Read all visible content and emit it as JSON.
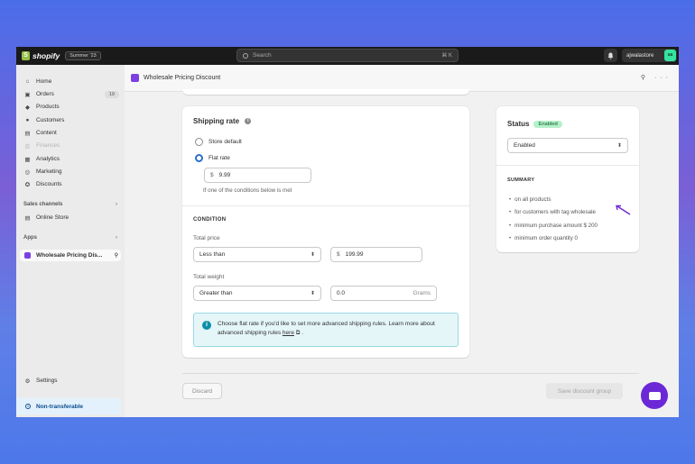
{
  "topbar": {
    "logo_letter": "S",
    "brand": "shopify",
    "edition": "Summer '23",
    "search_placeholder": "Search",
    "search_shortcut": "⌘ K",
    "store_name": "ajwalastore",
    "store_avatar": "aa"
  },
  "sidebar": {
    "items": [
      {
        "label": "Home",
        "icon": "home-icon",
        "glyph": "⌂"
      },
      {
        "label": "Orders",
        "icon": "orders-icon",
        "glyph": "▣",
        "count": "19"
      },
      {
        "label": "Products",
        "icon": "tag-icon",
        "glyph": "◆"
      },
      {
        "label": "Customers",
        "icon": "person-icon",
        "glyph": "●"
      },
      {
        "label": "Content",
        "icon": "content-icon",
        "glyph": "▤"
      },
      {
        "label": "Finances",
        "icon": "bank-icon",
        "glyph": "▥",
        "disabled": true
      },
      {
        "label": "Analytics",
        "icon": "chart-icon",
        "glyph": "▦"
      },
      {
        "label": "Marketing",
        "icon": "target-icon",
        "glyph": "◎"
      },
      {
        "label": "Discounts",
        "icon": "discount-icon",
        "glyph": "✪"
      }
    ],
    "sales_channels_label": "Sales channels",
    "online_store_label": "Online Store",
    "apps_label": "Apps",
    "app_item_label": "Wholesale Pricing Dis...",
    "settings_label": "Settings",
    "non_transferable_label": "Non-transferable"
  },
  "header": {
    "title": "Wholesale Pricing Discount",
    "actions": "⚲ ···"
  },
  "shipping": {
    "heading": "Shipping rate",
    "option_store_default": "Store default",
    "option_flat_rate": "Flat rate",
    "currency": "$",
    "flat_rate_value": "9.99",
    "flat_rate_help": "If one of the conditions below is met",
    "condition_heading": "CONDITION",
    "total_price_label": "Total price",
    "price_operator": "Less than",
    "price_value": "199.99",
    "total_weight_label": "Total weight",
    "weight_operator": "Greater than",
    "weight_value": "0.0",
    "weight_unit": "Grams",
    "banner_text": "Choose flat rate if you'd like to set more advanced shipping rules. Learn more about advanced shipping rules ",
    "banner_link": "here",
    "banner_end": " ."
  },
  "status": {
    "title": "Status",
    "badge": "Enabled",
    "select_value": "Enabled",
    "summary_heading": "SUMMARY",
    "summary_items": [
      "on all products",
      "for customers with tag wholesale",
      "minimum purchase amount $ 200",
      "minimum order quantity 0"
    ]
  },
  "footer": {
    "discard_label": "Discard",
    "save_label": "Save discount group"
  },
  "colors": {
    "accent": "#2c6ecb",
    "enabled_badge": "#b4f0c8",
    "banner_bg": "#e5f6f9",
    "chat": "#6b28d6",
    "arrow": "#6b28d6"
  }
}
